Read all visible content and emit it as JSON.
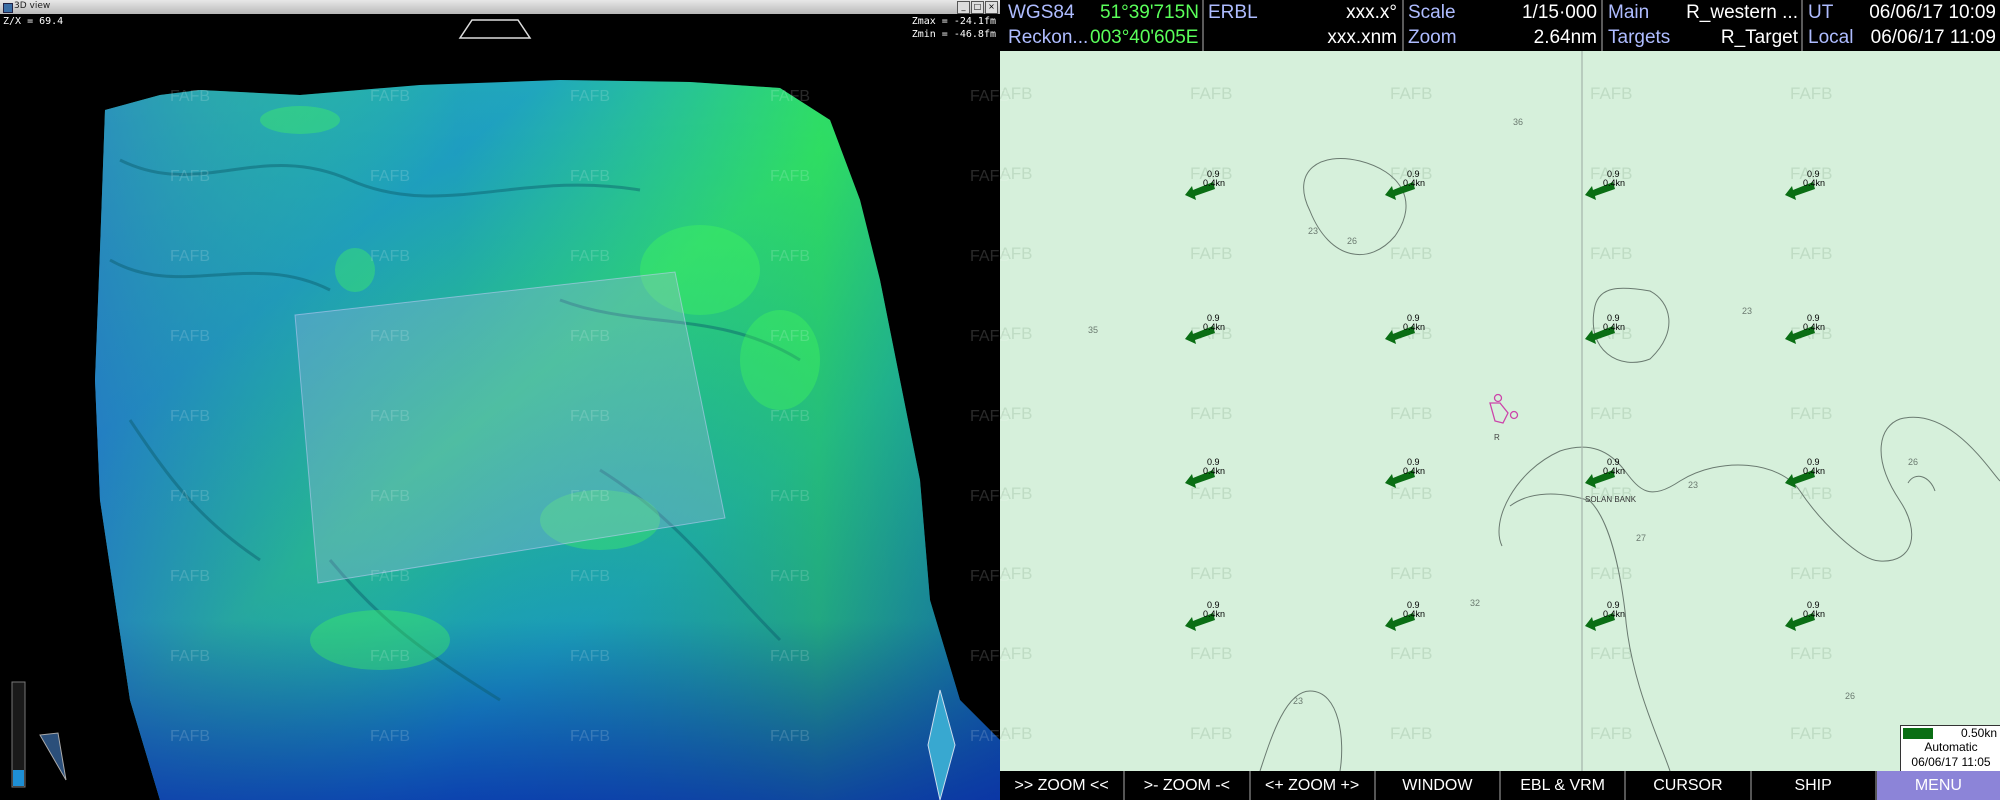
{
  "view3d": {
    "title": "3D view",
    "zx": "Z/X = 69.4",
    "zmax": "Zmax = -24.1fm",
    "zmin": "Zmin = -46.8fm",
    "watermark": "FAFB"
  },
  "infobar": {
    "datum": "WGS84",
    "lat": "51°39'715N",
    "mode": "Reckon...",
    "lon": "003°40'605E",
    "erbl_label": "ERBL",
    "erbl_bearing": "xxx.x°",
    "erbl_distance": "xxx.xnm",
    "scale_label": "Scale",
    "scale_value": "1/15·000",
    "zoom_label": "Zoom",
    "zoom_value": "2.64nm",
    "main_label": "Main",
    "main_value": "R_western ...",
    "targets_label": "Targets",
    "targets_value": "R_Target",
    "ut_label": "UT",
    "ut_value": "06/06/17 10:09",
    "local_label": "Local",
    "local_value": "06/06/17 11:09"
  },
  "map": {
    "watermark": "FAFB",
    "current_top": "0.9",
    "current_bottom": "0.4kn",
    "place_name": "SOLAN BANK",
    "ship_label": "R",
    "depths": [
      "36",
      "35",
      "32",
      "26",
      "26",
      "23",
      "23",
      "23",
      "23",
      "27",
      "26",
      "26"
    ],
    "current_color": "#0a6e14"
  },
  "legend": {
    "speed": "0.50kn",
    "mode": "Automatic",
    "timestamp": "06/06/17 11:05"
  },
  "commands": [
    ">> ZOOM <<",
    ">- ZOOM -<",
    "<+ ZOOM +>",
    "WINDOW",
    "EBL & VRM",
    "CURSOR",
    "SHIP",
    "MENU"
  ]
}
